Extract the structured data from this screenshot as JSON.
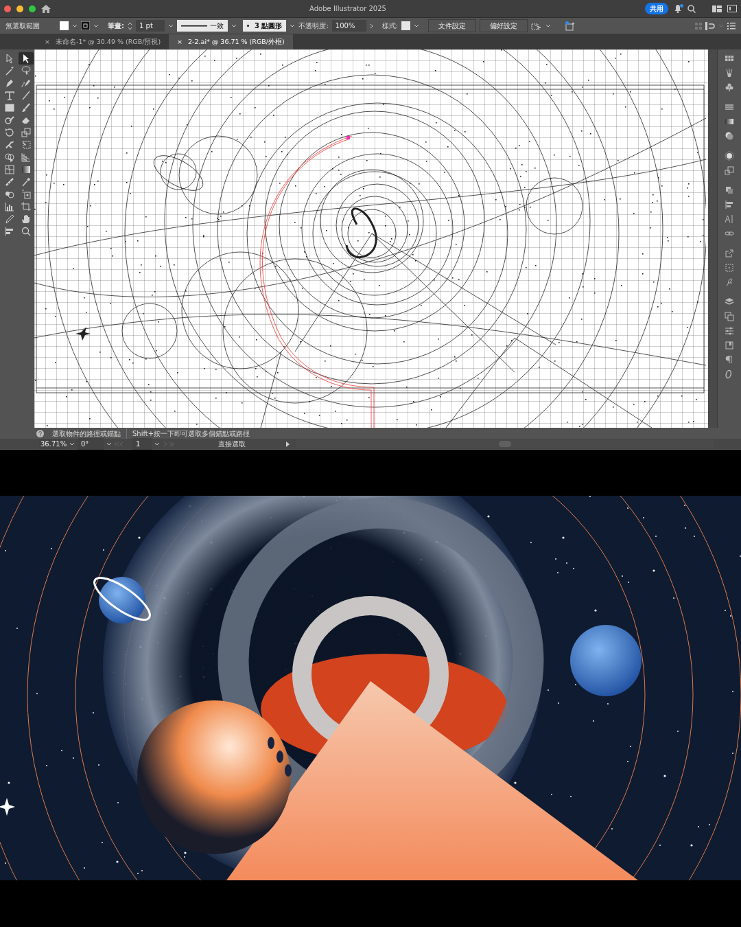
{
  "window": {
    "title": "Adobe Illustrator 2025",
    "share_button": "共用",
    "notification": true
  },
  "control_bar": {
    "selection": "無選取範圍",
    "stroke_label": "筆畫:",
    "stroke_weight": "1 pt",
    "stroke_profile": "一致",
    "brush": "3 點圓形",
    "opacity_label": "不透明度:",
    "opacity": "100%",
    "style_label": "樣式:",
    "buttons": [
      "文件設定",
      "偏好設定"
    ]
  },
  "tabs": [
    {
      "label": "未命名-1* @ 30.49 % (RGB/預視)",
      "close": "×",
      "selected": false
    },
    {
      "label": "2-2.ai* @ 36.71 % (RGB/外框)",
      "close": "×",
      "selected": true
    }
  ],
  "tools": [
    {
      "kind": "selection",
      "selected": false
    },
    {
      "kind": "direct-selection",
      "selected": true
    },
    {
      "kind": "wand",
      "selected": false
    },
    {
      "kind": "lasso",
      "selected": false
    },
    {
      "kind": "pen",
      "selected": false
    },
    {
      "kind": "curvature",
      "selected": false
    },
    {
      "kind": "type",
      "selected": false
    },
    {
      "kind": "line",
      "selected": false
    },
    {
      "kind": "rectangle",
      "selected": false
    },
    {
      "kind": "brush",
      "selected": false
    },
    {
      "kind": "shaper",
      "selected": false
    },
    {
      "kind": "eraser",
      "selected": false
    },
    {
      "kind": "rotate",
      "selected": false
    },
    {
      "kind": "scale",
      "selected": false
    },
    {
      "kind": "warp",
      "selected": false
    },
    {
      "kind": "transform",
      "selected": false
    },
    {
      "kind": "shape-builder",
      "selected": false
    },
    {
      "kind": "perspective",
      "selected": false
    },
    {
      "kind": "mesh",
      "selected": false
    },
    {
      "kind": "gradient",
      "selected": false
    },
    {
      "kind": "blend",
      "selected": false
    },
    {
      "kind": "eyedropper",
      "selected": false
    },
    {
      "kind": "sprayer",
      "selected": false
    },
    {
      "kind": "graph-plus",
      "selected": false
    },
    {
      "kind": "graph",
      "selected": false
    },
    {
      "kind": "artboard",
      "selected": false
    },
    {
      "kind": "pencil",
      "selected": false
    },
    {
      "kind": "hand",
      "selected": false
    },
    {
      "kind": "align",
      "selected": false
    },
    {
      "kind": "zoom",
      "selected": false
    }
  ],
  "status_bar": {
    "hint": "選取物件的路徑或錨點",
    "hint_shift": "Shift+按一下即可選取多個錨點或路徑",
    "zoom": "36.71%",
    "rotation": "0°",
    "artboard": "1",
    "current_tool": "直接選取"
  }
}
